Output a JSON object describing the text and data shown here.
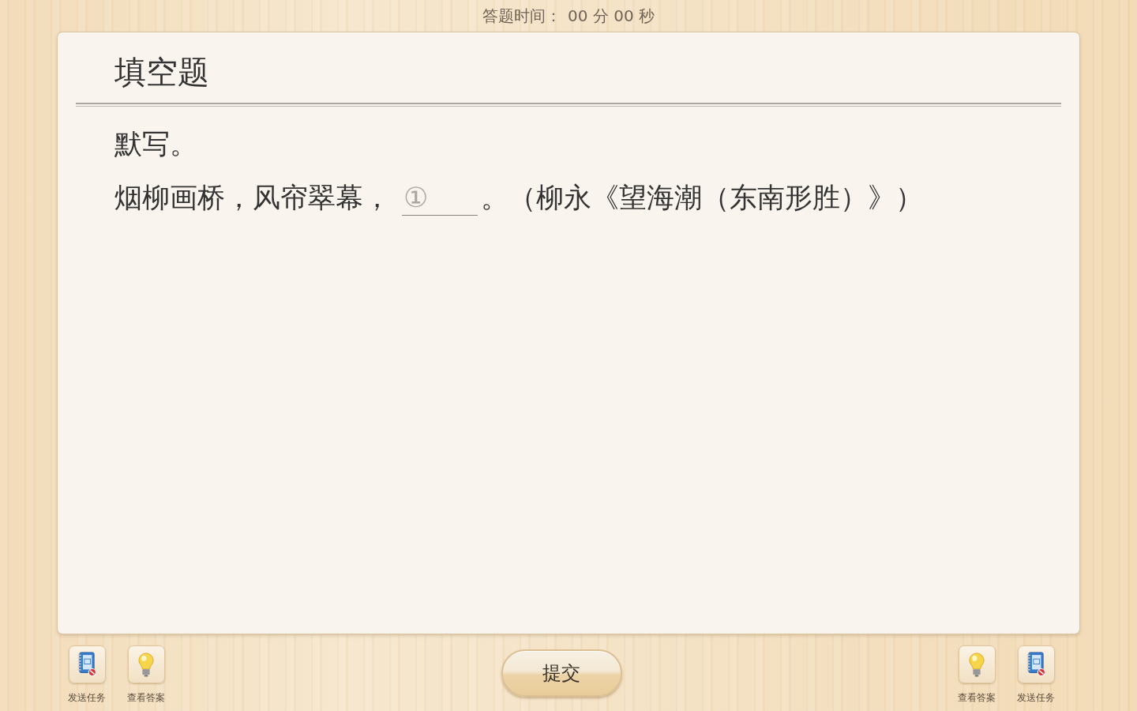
{
  "timer": {
    "label": "答题时间：",
    "value": "00 分 00 秒"
  },
  "question": {
    "type_title": "填空题",
    "instruction": "默写。",
    "parts": [
      {
        "kind": "text",
        "text": "烟柳画桥，风帘翠幕，"
      },
      {
        "kind": "blank",
        "label": "①"
      },
      {
        "kind": "text",
        "text": "。（柳永《望海潮（东南形胜）》）"
      }
    ]
  },
  "left_tools": [
    {
      "kind": "send",
      "label": "发送任务"
    },
    {
      "kind": "answer",
      "label": "查看答案"
    }
  ],
  "submit_button": "提交",
  "right_tools": [
    {
      "kind": "answer",
      "label": "查看答案"
    },
    {
      "kind": "send",
      "label": "发送任务"
    }
  ]
}
